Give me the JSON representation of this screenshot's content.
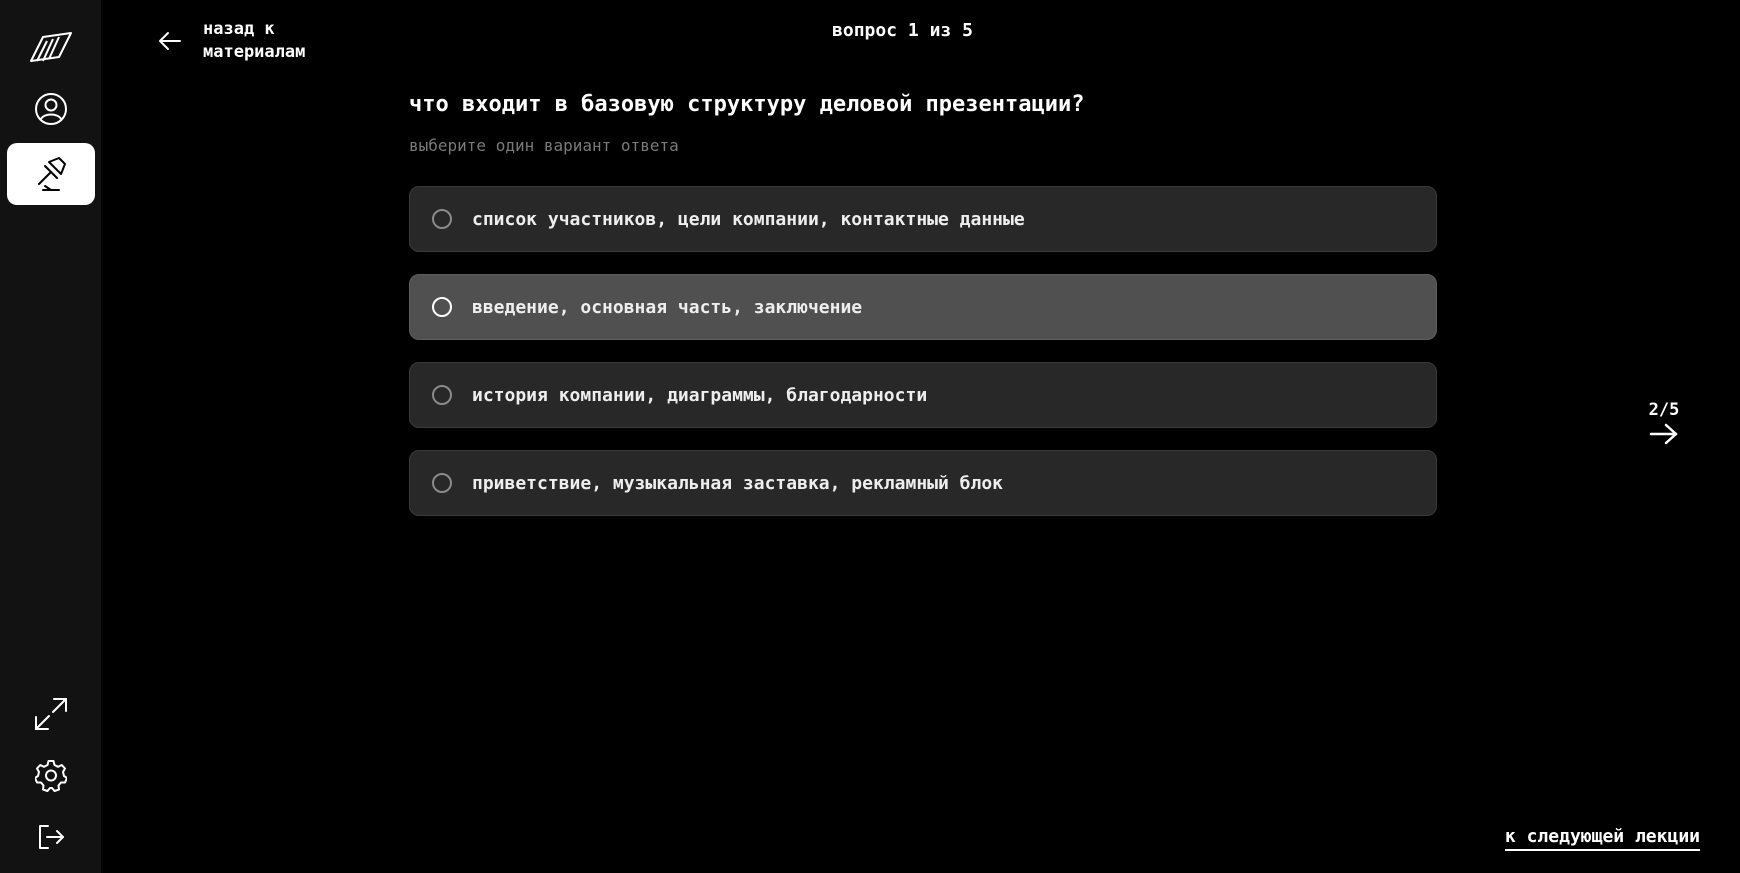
{
  "sidebar": {
    "items": [
      {
        "icon": "logo-icon"
      },
      {
        "icon": "profile-icon"
      },
      {
        "icon": "pin-icon",
        "active": true
      },
      {
        "icon": "expand-icon"
      },
      {
        "icon": "gear-icon"
      },
      {
        "icon": "logout-icon"
      }
    ]
  },
  "header": {
    "back_label": "назад к материалам",
    "counter": "вопрос 1 из 5"
  },
  "question": {
    "title": "что входит в базовую структуру деловой презентации?",
    "hint": "выберите один вариант ответа",
    "options": [
      {
        "label": "список участников, цели компании, контактные данные",
        "selected": false
      },
      {
        "label": "введение, основная часть, заключение",
        "selected": false,
        "hovered": true
      },
      {
        "label": "история компании, диаграммы, благодарности",
        "selected": false
      },
      {
        "label": "приветствие, музыкальная заставка, рекламный блок",
        "selected": false
      }
    ]
  },
  "navigation": {
    "next_counter": "2/5",
    "next_lecture_label": "к следующей лекции"
  },
  "colors": {
    "background": "#000000",
    "sidebar": "#121212",
    "option_bg": "#282828",
    "option_hover_bg": "#505050",
    "hint": "#7a7a7a"
  }
}
